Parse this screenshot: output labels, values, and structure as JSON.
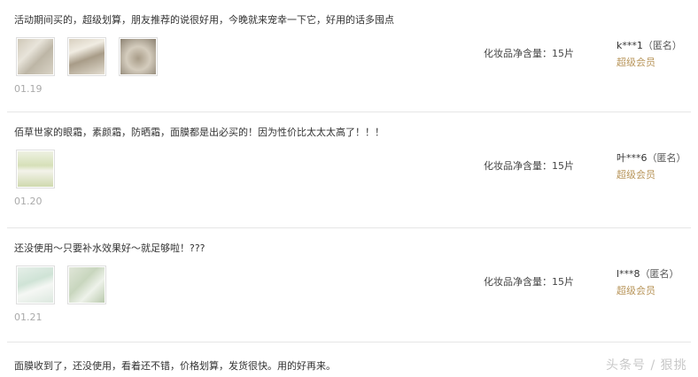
{
  "reviews": [
    {
      "content": "活动期间买的，超级划算，朋友推荐的说很好用，今晚就来宠幸一下它，好用的话多囤点",
      "date": "01.19",
      "spec": "化妆品净含量：15片",
      "user": "k***1",
      "anon": "（匿名）",
      "level": "超级会员",
      "photos": [
        "photo-1",
        "photo-2",
        "photo-3"
      ]
    },
    {
      "content": "佰草世家的眼霜，素颜霜，防晒霜，面膜都是出必买的！因为性价比太太太高了！！！",
      "date": "01.20",
      "spec": "化妆品净含量：15片",
      "user": "叶***6",
      "anon": "（匿名）",
      "level": "超级会员",
      "photos": [
        "photo-1"
      ]
    },
    {
      "content": "还没使用～只要补水效果好～就足够啦！???",
      "date": "01.21",
      "spec": "化妆品净含量：15片",
      "user": "l***8",
      "anon": "（匿名）",
      "level": "超级会员",
      "photos": [
        "photo-1",
        "photo-2"
      ]
    }
  ],
  "last_review": {
    "content": "面膜收到了，还没使用，看着还不错，价格划算，发货很快。用的好再来。"
  },
  "watermark": "头条号 / 狠挑"
}
